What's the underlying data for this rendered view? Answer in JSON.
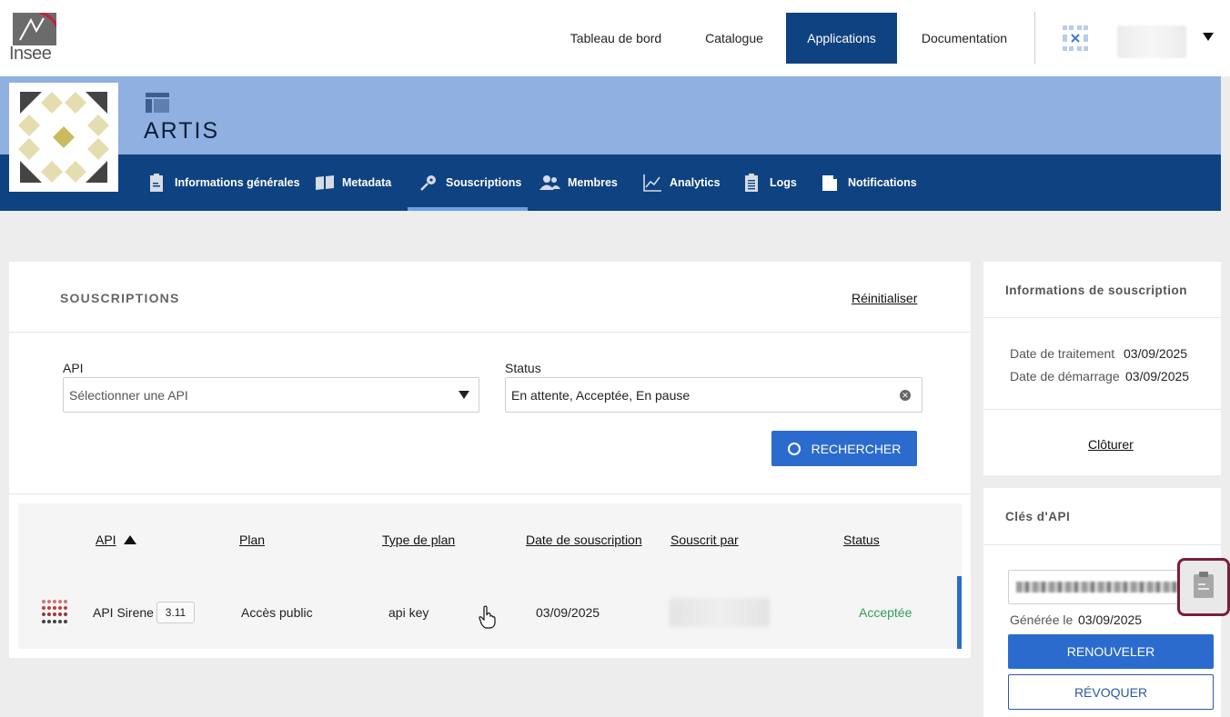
{
  "brand": {
    "logo_text": "Insee"
  },
  "topnav": {
    "items": [
      {
        "label": "Tableau de bord"
      },
      {
        "label": "Catalogue"
      },
      {
        "label": "Applications"
      },
      {
        "label": "Documentation"
      }
    ],
    "active": "Applications"
  },
  "app": {
    "title": "ARTIS",
    "tabs": [
      {
        "label": "Informations générales",
        "icon": "clipboard-icon"
      },
      {
        "label": "Metadata",
        "icon": "book-icon"
      },
      {
        "label": "Souscriptions",
        "icon": "key-icon"
      },
      {
        "label": "Membres",
        "icon": "people-icon"
      },
      {
        "label": "Analytics",
        "icon": "chart-icon"
      },
      {
        "label": "Logs",
        "icon": "list-icon"
      },
      {
        "label": "Notifications",
        "icon": "notification-icon"
      }
    ],
    "active_tab": "Souscriptions"
  },
  "subscriptions": {
    "title": "SOUSCRIPTIONS",
    "reset_label": "Réinitialiser",
    "api_filter": {
      "label": "API",
      "placeholder": "Sélectionner une API"
    },
    "status_filter": {
      "label": "Status",
      "value": "En attente, Acceptée, En pause"
    },
    "search_label": "RECHERCHER",
    "columns": [
      "API",
      "Plan",
      "Type de plan",
      "Date de souscription",
      "Souscrit par",
      "Status"
    ],
    "rows": [
      {
        "api": "API Sirene",
        "version": "3.11",
        "plan": "Accès public",
        "plan_type": "api key",
        "date": "03/09/2025",
        "status": "Acceptée"
      }
    ]
  },
  "subscription_info": {
    "title": "Informations de souscription",
    "processing_label": "Date de traitement",
    "processing_value": "03/09/2025",
    "start_label": "Date de démarrage",
    "start_value": "03/09/2025",
    "close_label": "Clôturer"
  },
  "api_keys": {
    "title": "Clés d'API",
    "generated_label": "Générée le",
    "generated_value": "03/09/2025",
    "renew_label": "RENOUVELER",
    "revoke_label": "RÉVOQUER"
  },
  "colors": {
    "primary": "#0f4280",
    "banner": "#8fb0e0",
    "button": "#2c6bce",
    "accepted": "#2e9e5a",
    "highlight": "#7a1e3c"
  }
}
